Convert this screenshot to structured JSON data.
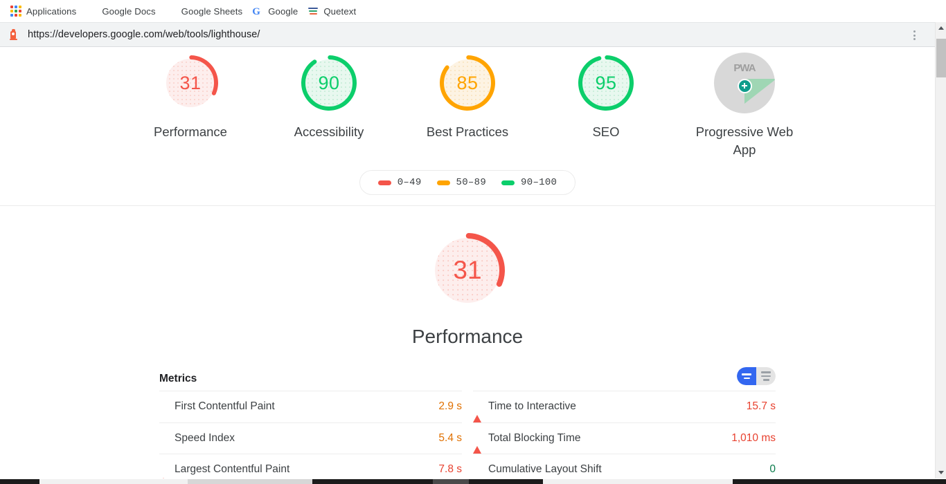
{
  "browser": {
    "bookmarks": [
      {
        "label": "Applications",
        "icon": "apps-grid-icon"
      },
      {
        "label": "Google Docs",
        "icon": "google-docs-icon"
      },
      {
        "label": "Google Sheets",
        "icon": "google-sheets-icon"
      },
      {
        "label": "Google",
        "icon": "google-icon",
        "glyph": "G"
      },
      {
        "label": "Quetext",
        "icon": "quetext-icon"
      }
    ],
    "url": "https://developers.google.com/web/tools/lighthouse/",
    "favicon": "lighthouse-icon",
    "menu_icon": "kebab-menu-icon"
  },
  "scores": {
    "gauges": [
      {
        "label": "Performance",
        "value": "31",
        "score": 31,
        "color": "#f4554a",
        "fill": "#fdeeed",
        "type": "ring"
      },
      {
        "label": "Accessibility",
        "value": "90",
        "score": 90,
        "color": "#0cce6b",
        "fill": "#e8f8ef",
        "type": "ring"
      },
      {
        "label": "Best Practices",
        "value": "85",
        "score": 85,
        "color": "#ffa400",
        "fill": "#fdf3e3",
        "type": "ring"
      },
      {
        "label": "SEO",
        "value": "95",
        "score": 95,
        "color": "#0cce6b",
        "fill": "#e8f8ef",
        "type": "ring"
      },
      {
        "label": "Progressive Web App",
        "value": "PWA",
        "score": null,
        "color": "#9e9e9e",
        "fill": "#d8d8d8",
        "type": "pwa-badge"
      }
    ],
    "legend": [
      {
        "label": "0–49",
        "color": "#f4554a"
      },
      {
        "label": "50–89",
        "color": "#ffa400"
      },
      {
        "label": "90–100",
        "color": "#0cce6b"
      }
    ]
  },
  "category": {
    "title": "Performance",
    "score_value": "31",
    "score": 31,
    "color": "#f4554a",
    "fill": "#fdeeed"
  },
  "metrics": {
    "title": "Metrics",
    "toggle": {
      "active": "simple-view",
      "options": [
        {
          "name": "simple-view",
          "selected": true
        },
        {
          "name": "expanded-view",
          "selected": false
        }
      ]
    },
    "left_column": [
      {
        "name": "First Contentful Paint",
        "value": "2.9 s",
        "status": "average",
        "indicator": "square",
        "color": "#ffa400"
      },
      {
        "name": "Speed Index",
        "value": "5.4 s",
        "status": "average",
        "indicator": "square",
        "color": "#ffa400"
      },
      {
        "name": "Largest Contentful Paint",
        "value": "7.8 s",
        "status": "poor",
        "indicator": "triangle",
        "color": "#f4554a"
      }
    ],
    "right_column": [
      {
        "name": "Time to Interactive",
        "value": "15.7 s",
        "status": "poor",
        "indicator": "triangle",
        "color": "#f4554a"
      },
      {
        "name": "Total Blocking Time",
        "value": "1,010 ms",
        "status": "poor",
        "indicator": "triangle",
        "color": "#f4554a"
      },
      {
        "name": "Cumulative Layout Shift",
        "value": "0",
        "status": "good",
        "indicator": "circle",
        "color": "#00c853"
      }
    ]
  },
  "scrollbar": {
    "up_icon": "scroll-up-arrow-icon",
    "down_icon": "scroll-down-arrow-icon"
  }
}
